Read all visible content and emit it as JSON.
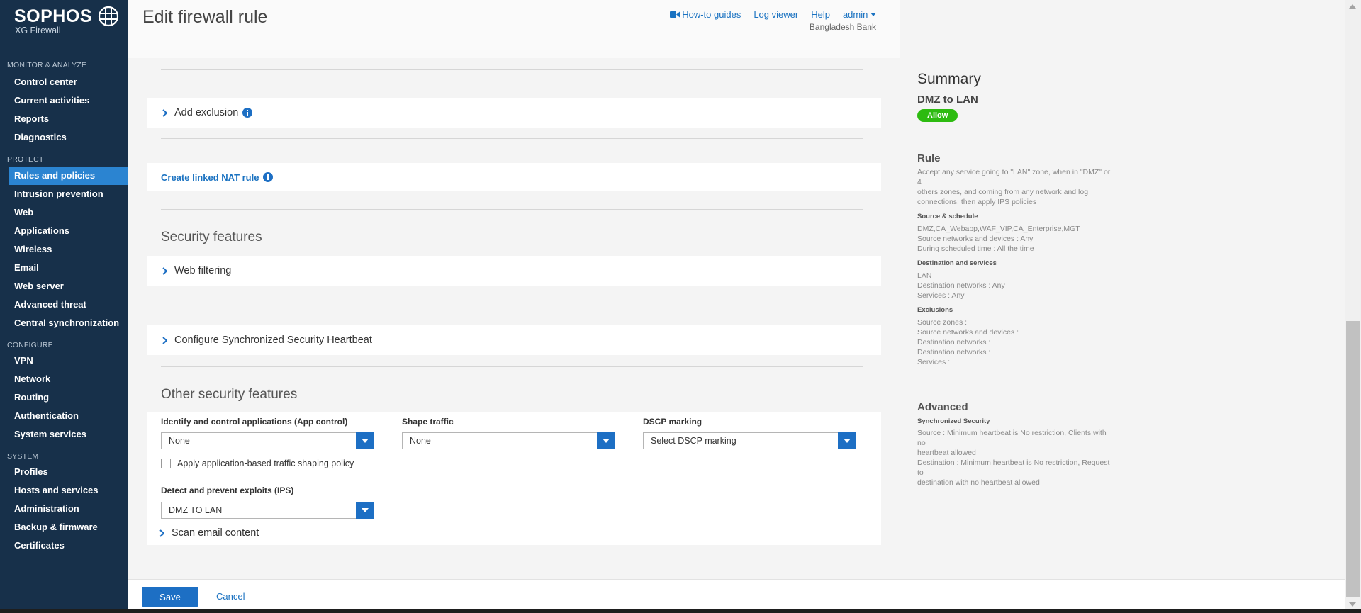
{
  "brand": {
    "name": "SOPHOS",
    "product": "XG Firewall"
  },
  "sidebar": {
    "sections": [
      {
        "title": "MONITOR & ANALYZE",
        "items": [
          "Control center",
          "Current activities",
          "Reports",
          "Diagnostics"
        ]
      },
      {
        "title": "PROTECT",
        "items": [
          "Rules and policies",
          "Intrusion prevention",
          "Web",
          "Applications",
          "Wireless",
          "Email",
          "Web server",
          "Advanced threat",
          "Central synchronization"
        ]
      },
      {
        "title": "CONFIGURE",
        "items": [
          "VPN",
          "Network",
          "Routing",
          "Authentication",
          "System services"
        ]
      },
      {
        "title": "SYSTEM",
        "items": [
          "Profiles",
          "Hosts and services",
          "Administration",
          "Backup & firmware",
          "Certificates"
        ]
      }
    ],
    "active": "Rules and policies"
  },
  "header": {
    "title": "Edit firewall rule",
    "links": {
      "guides": "How-to guides",
      "log_viewer": "Log viewer",
      "help": "Help",
      "user": "admin"
    },
    "org": "Bangladesh Bank"
  },
  "main": {
    "add_exclusion": "Add exclusion",
    "create_nat": "Create linked NAT rule",
    "security_features_title": "Security features",
    "web_filtering": "Web filtering",
    "heartbeat": "Configure Synchronized Security Heartbeat",
    "other_features_title": "Other security features",
    "app_control": {
      "label": "Identify and control applications (App control)",
      "value": "None"
    },
    "shape_traffic": {
      "label": "Shape traffic",
      "value": "None"
    },
    "dscp": {
      "label": "DSCP marking",
      "value": "Select DSCP marking"
    },
    "app_shaping_checkbox": {
      "label": "Apply application-based traffic shaping policy",
      "checked": false
    },
    "ips": {
      "label": "Detect and prevent exploits (IPS)",
      "value": "DMZ TO LAN"
    },
    "scan_email": "Scan email content"
  },
  "footer": {
    "save": "Save",
    "cancel": "Cancel"
  },
  "summary": {
    "title": "Summary",
    "rule_name": "DMZ to LAN",
    "action": "Allow",
    "rule_heading": "Rule",
    "rule_desc": [
      "Accept any service going to \"LAN\" zone, when in \"DMZ\" or 4",
      "others zones, and coming from any network and log",
      "connections, then apply IPS policies"
    ],
    "source_heading": "Source & schedule",
    "source_lines": [
      "DMZ,CA_Webapp,WAF_VIP,CA_Enterprise,MGT",
      "Source networks and devices : Any",
      "During scheduled time : All the time"
    ],
    "dest_heading": "Destination and services",
    "dest_lines": [
      "LAN",
      "Destination networks : Any",
      "Services : Any"
    ],
    "excl_heading": "Exclusions",
    "excl_lines": [
      "Source zones :",
      "Source networks and devices :",
      "Destination networks :",
      "Destination networks :",
      "Services :"
    ],
    "adv_heading": "Advanced",
    "sync_heading": "Synchronized Security",
    "sync_lines": [
      "Source : Minimum heartbeat is No restriction, Clients with no",
      "heartbeat allowed",
      "Destination : Minimum heartbeat is No restriction, Request to",
      "destination with no heartbeat allowed"
    ]
  },
  "colors": {
    "sidebar_bg": "#17304a",
    "accent": "#1d6fc4",
    "active_nav": "#2b84d1",
    "allow_badge": "#2dbb10"
  }
}
